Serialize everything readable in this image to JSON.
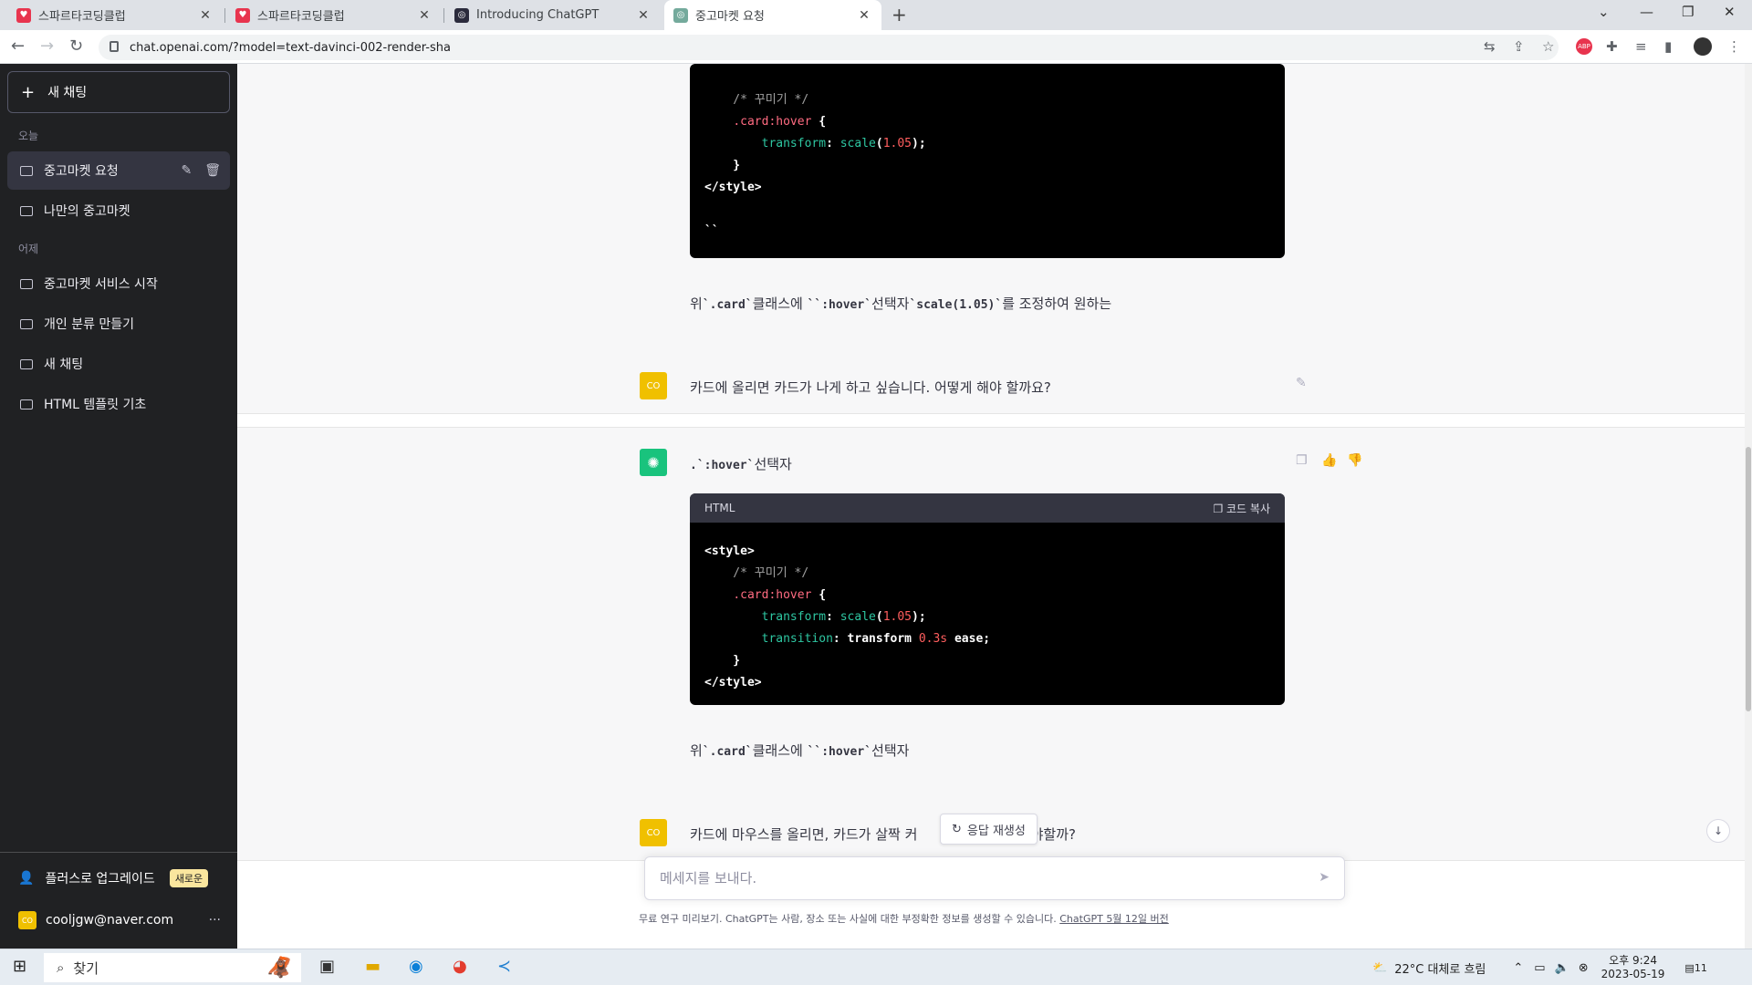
{
  "browser": {
    "tabs": [
      {
        "title": "스파르타코딩클럽",
        "favicon_color": "#e8344e"
      },
      {
        "title": "스파르타코딩클럽",
        "favicon_color": "#e8344e"
      },
      {
        "title": "Introducing ChatGPT",
        "favicon_color": "#2b2b3c"
      },
      {
        "title": "중고마켓 요청",
        "favicon_color": "#74aa9c"
      }
    ],
    "url": "chat.openai.com/?model=text-davinci-002-render-sha"
  },
  "sidebar": {
    "new_chat": "새 채팅",
    "groups": [
      {
        "label": "오늘",
        "items": [
          "중고마켓 요청",
          "나만의 중고마켓"
        ]
      },
      {
        "label": "어제",
        "items": [
          "중고마켓 서비스 시작",
          "개인 분류 만들기",
          "새 채팅",
          "HTML 템플릿 기초"
        ]
      }
    ],
    "upgrade": "플러스로 업그레이드",
    "upgrade_badge": "새로운",
    "user_email": "cooljgw@naver.com",
    "user_initials": "CO"
  },
  "chat": {
    "code1": {
      "lines": [
        [
          {
            "t": "    /* 꾸미기 */",
            "c": "t-c"
          }
        ],
        [
          {
            "t": "    ",
            "c": ""
          },
          {
            "t": ".card:hover",
            "c": "t-s"
          },
          {
            "t": " {",
            "c": "t-w"
          }
        ],
        [
          {
            "t": "        ",
            "c": ""
          },
          {
            "t": "transform",
            "c": "t-p"
          },
          {
            "t": ": ",
            "c": "t-w"
          },
          {
            "t": "scale",
            "c": "t-p"
          },
          {
            "t": "(",
            "c": "t-w"
          },
          {
            "t": "1.05",
            "c": "t-n"
          },
          {
            "t": ");",
            "c": "t-w"
          }
        ],
        [
          {
            "t": "    }",
            "c": "t-w"
          }
        ],
        [
          {
            "t": "</style>",
            "c": "t-w"
          }
        ],
        [
          {
            "t": "",
            "c": ""
          }
        ],
        [
          {
            "t": "``",
            "c": "t-w"
          }
        ]
      ]
    },
    "answer1_text": {
      "a": "위",
      "b": "`.card`",
      "c": "클래스에 ",
      "d": "``:hover`",
      "e": "선택자",
      "f": "`scale(1.05)`",
      "g": "를 조정하여 원하는"
    },
    "question1": "카드에 올리면 카드가 나게 하고 싶습니다. 어떻게 해야 할까요?",
    "answer2_intro": {
      "a": ".`:hover`",
      "b": "선택자"
    },
    "code2": {
      "lang": "HTML",
      "copy_label": "코드 복사",
      "lines": [
        [
          {
            "t": "<style>",
            "c": "t-w"
          }
        ],
        [
          {
            "t": "    /* 꾸미기 */",
            "c": "t-c"
          }
        ],
        [
          {
            "t": "    ",
            "c": ""
          },
          {
            "t": ".card:hover",
            "c": "t-s"
          },
          {
            "t": " {",
            "c": "t-w"
          }
        ],
        [
          {
            "t": "        ",
            "c": ""
          },
          {
            "t": "transform",
            "c": "t-p"
          },
          {
            "t": ": ",
            "c": "t-w"
          },
          {
            "t": "scale",
            "c": "t-p"
          },
          {
            "t": "(",
            "c": "t-w"
          },
          {
            "t": "1.05",
            "c": "t-n"
          },
          {
            "t": ");",
            "c": "t-w"
          }
        ],
        [
          {
            "t": "        ",
            "c": ""
          },
          {
            "t": "transition",
            "c": "t-p"
          },
          {
            "t": ": transform ",
            "c": "t-w"
          },
          {
            "t": "0.3s",
            "c": "t-n"
          },
          {
            "t": " ease;",
            "c": "t-w"
          }
        ],
        [
          {
            "t": "    }",
            "c": "t-w"
          }
        ],
        [
          {
            "t": "</style>",
            "c": "t-w"
          }
        ]
      ]
    },
    "answer2_text": {
      "a": "위",
      "b": "`.card`",
      "c": "클래스에 ",
      "d": "``:hover`",
      "e": "선택자"
    },
    "question2_left": "카드에 마우스를 올리면, 카드가 살짝 커",
    "question2_right": "떻게 해야할까?",
    "regenerate": "응답 재생성",
    "input_placeholder": "메세지를 보내다.",
    "footnote": "무료 연구 미리보기. ChatGPT는 사람, 장소 또는 사실에 대한 부정확한 정보를 생성할 수 있습니다.",
    "footnote_link": "ChatGPT 5월 12일 버전"
  },
  "taskbar": {
    "search": "찾기",
    "weather": "22°C  대체로 흐림",
    "time": "오후 9:24",
    "date": "2023-05-19",
    "notif": "11"
  }
}
